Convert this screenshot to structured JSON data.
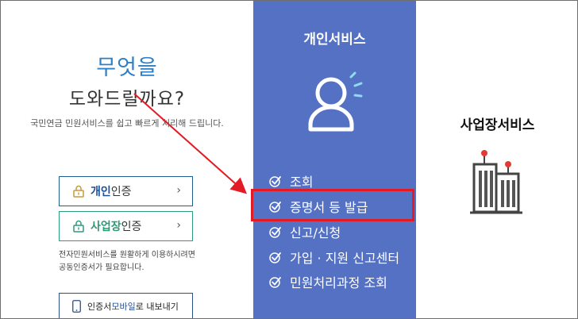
{
  "help": {
    "title": "무엇을",
    "subtitle": "도와드릴까요?",
    "description": "국민연금 민원서비스를 쉽고 빠르게 처리해 드립니다."
  },
  "auth": {
    "personal": {
      "strong": "개인",
      "rest": " 인증",
      "arrow": "›"
    },
    "business": {
      "strong": "사업장",
      "rest": " 인증",
      "arrow": "›"
    },
    "note_line1": "전자민원서비스를 원활하게 이용하시려면",
    "note_line2": "공동인증서가 필요합니다.",
    "mobile": {
      "prefix": "인증서 ",
      "highlight": "모바일",
      "suffix": "로 내보내기"
    }
  },
  "personal_services": {
    "title": "개인서비스",
    "items": [
      "조회",
      "증명서 등 발급",
      "신고/신청",
      "가입 · 지원 신고센터",
      "민원처리과정 조회"
    ]
  },
  "business_services": {
    "title": "사업장서비스"
  },
  "colors": {
    "personal_bg": "#5471c4",
    "highlight": "#e21b24",
    "accent_blue": "#2f7fc4"
  }
}
